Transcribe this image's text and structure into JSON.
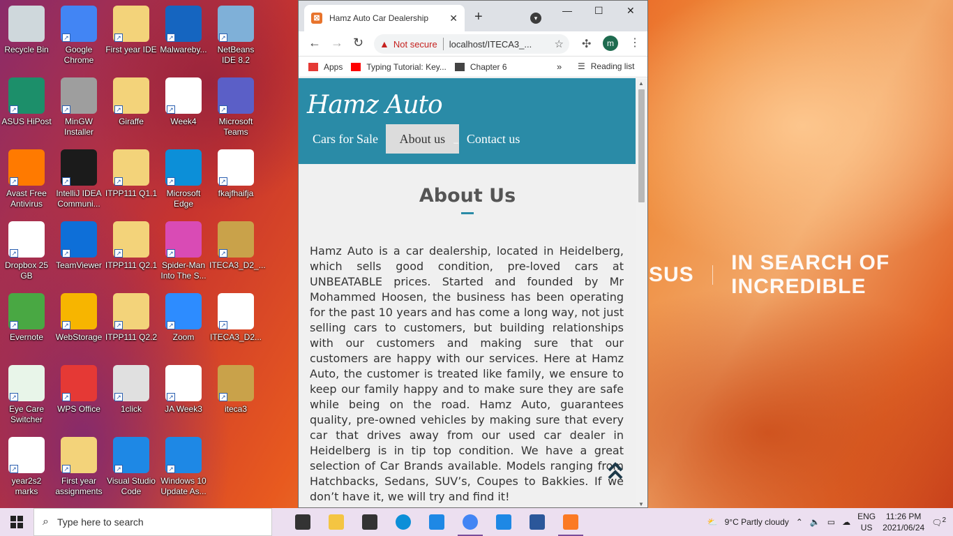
{
  "desktop": {
    "icons": [
      {
        "label": "Recycle Bin",
        "color": "#cfd8dc"
      },
      {
        "label": "Google Chrome",
        "color": "#4285f4"
      },
      {
        "label": "First year IDE",
        "color": "#f3d37a"
      },
      {
        "label": "Malwareby...",
        "color": "#1565c0"
      },
      {
        "label": "NetBeans IDE 8.2",
        "color": "#7fb0d8"
      },
      {
        "label": "ASUS HiPost",
        "color": "#1c8f6a"
      },
      {
        "label": "MinGW Installer",
        "color": "#9e9e9e"
      },
      {
        "label": "Giraffe",
        "color": "#f3d37a"
      },
      {
        "label": "Week4",
        "color": "#ffffff"
      },
      {
        "label": "Microsoft Teams",
        "color": "#5b5fc7"
      },
      {
        "label": "Avast Free Antivirus",
        "color": "#ff7a00"
      },
      {
        "label": "IntelliJ IDEA Communi...",
        "color": "#1b1b1b"
      },
      {
        "label": "ITPP111 Q1.1",
        "color": "#f3d37a"
      },
      {
        "label": "Microsoft Edge",
        "color": "#0c8fd8"
      },
      {
        "label": "fkajfhaifja",
        "color": "#ffffff"
      },
      {
        "label": "Dropbox 25 GB",
        "color": "#ffffff"
      },
      {
        "label": "TeamViewer",
        "color": "#0e6fd8"
      },
      {
        "label": "ITPP111 Q2.1",
        "color": "#f3d37a"
      },
      {
        "label": "Spider-Man Into The S...",
        "color": "#d94bb5"
      },
      {
        "label": "ITECA3_D2_...",
        "color": "#c9a24a"
      },
      {
        "label": "Evernote",
        "color": "#49a843"
      },
      {
        "label": "WebStorage",
        "color": "#f7b500"
      },
      {
        "label": "ITPP111 Q2.2",
        "color": "#f3d37a"
      },
      {
        "label": "Zoom",
        "color": "#2d8cff"
      },
      {
        "label": "ITECA3_D2...",
        "color": "#ffffff"
      },
      {
        "label": "Eye Care Switcher",
        "color": "#e8f5e9"
      },
      {
        "label": "WPS Office",
        "color": "#e53935"
      },
      {
        "label": "1click",
        "color": "#e0e0e0"
      },
      {
        "label": "JA Week3",
        "color": "#ffffff"
      },
      {
        "label": "iteca3",
        "color": "#c9a24a"
      },
      {
        "label": "year2s2 marks",
        "color": "#ffffff"
      },
      {
        "label": "First year assignments",
        "color": "#f3d37a"
      },
      {
        "label": "Visual Studio Code",
        "color": "#1e88e5"
      },
      {
        "label": "Windows 10 Update As...",
        "color": "#1e88e5"
      }
    ],
    "wallpaper_brand": "SUS",
    "wallpaper_slogan": "IN SEARCH OF INCREDIBLE"
  },
  "browser": {
    "tab_title": "Hamz Auto Car Dealership",
    "security_label": "Not secure",
    "url": "localhost/ITECA3_...",
    "avatar_letter": "m",
    "bookmarks": [
      {
        "label": "Apps",
        "color": "#e53935"
      },
      {
        "label": "Typing Tutorial: Key...",
        "color": "#ff0000"
      },
      {
        "label": "Chapter 6",
        "color": "#444444"
      }
    ],
    "more_bookmarks": "»",
    "reading_list": "Reading list"
  },
  "site": {
    "brand": "Hamz Auto",
    "header_color": "#2a8ba7",
    "nav": [
      {
        "label": "Cars for Sale",
        "active": false
      },
      {
        "label": "About us",
        "active": true
      },
      {
        "label": "Contact us",
        "active": false
      }
    ],
    "section_title": "About Us",
    "about_text": "Hamz Auto is a car dealership, located in Heidelberg, which sells good condition, pre-loved cars at UNBEATABLE prices. Started and founded by Mr Mohammed Hoosen, the business has been operating for the past 10 years and has come a long way, not just selling cars to customers, but building relationships with our customers and making sure that our customers are happy with our services. Here at Hamz Auto, the customer is treated like family, we ensure to keep our family happy and to make sure they are safe while being on the road. Hamz Auto, guarantees quality, pre-owned vehicles by making sure that every car that drives away from our used car dealer in Heidelberg is in tip top condition. We have a great selection of Car Brands available. Models ranging from Hatchbacks, Sedans, SUV’s, Coupes to Bakkies. If we don’t have it, we will try and find it!"
  },
  "taskbar": {
    "search_placeholder": "Type here to search",
    "pinned": [
      {
        "name": "task-view-icon",
        "color": "#333333"
      },
      {
        "name": "file-explorer-icon",
        "color": "#f4c542"
      },
      {
        "name": "store-icon",
        "color": "#333333"
      },
      {
        "name": "edge-icon",
        "color": "#0c8fd8"
      },
      {
        "name": "mail-icon",
        "color": "#1e88e5"
      },
      {
        "name": "chrome-icon",
        "color": "#4285f4"
      },
      {
        "name": "vscode-icon",
        "color": "#1e88e5"
      },
      {
        "name": "word-icon",
        "color": "#2b579a"
      },
      {
        "name": "xampp-icon",
        "color": "#fb7a24"
      }
    ],
    "weather": "9°C  Partly cloudy",
    "lang_top": "ENG",
    "lang_bottom": "US",
    "time": "11:26 PM",
    "date": "2021/06/24",
    "notifications": "2"
  }
}
